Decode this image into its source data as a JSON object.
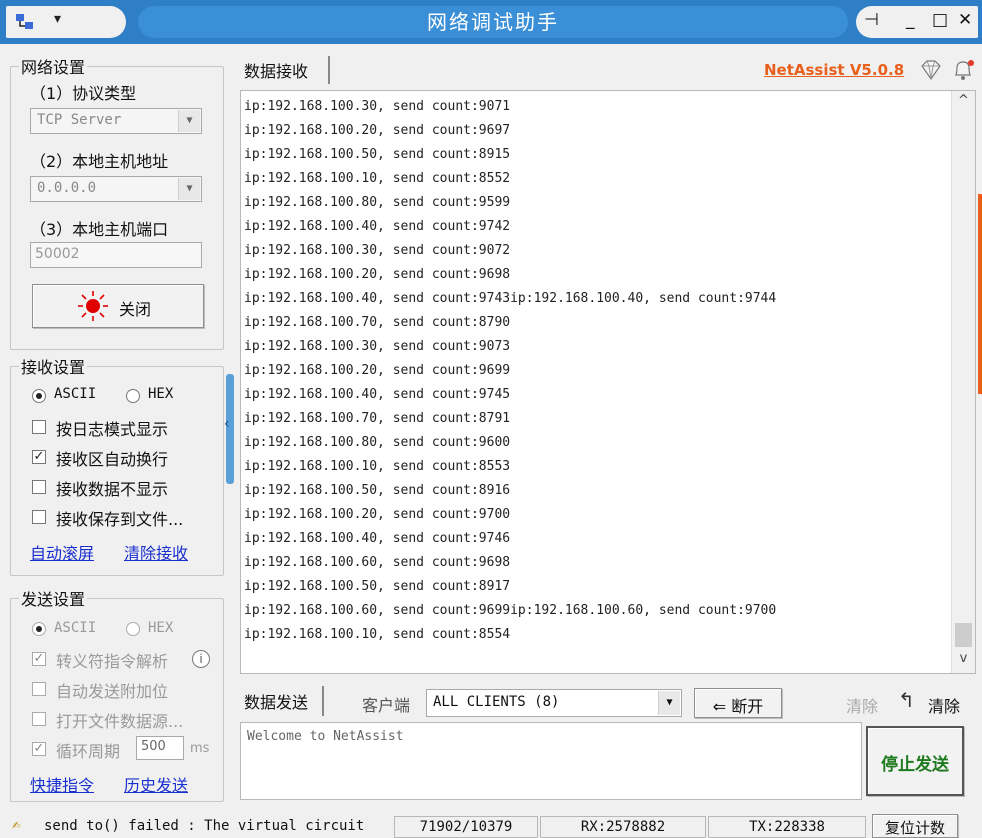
{
  "window": {
    "title": "网络调试助手",
    "brand": "NetAssist V5.0.8"
  },
  "network_settings": {
    "group": "网络设置",
    "protocol_label": "（1）协议类型",
    "protocol_value": "TCP Server",
    "host_label": "（2）本地主机地址",
    "host_value": "0.0.0.0",
    "port_label": "（3）本地主机端口",
    "port_value": "50002",
    "close_button": "关闭"
  },
  "receive_settings": {
    "group": "接收设置",
    "ascii": "ASCII",
    "hex": "HEX",
    "options": [
      "按日志模式显示",
      "接收区自动换行",
      "接收数据不显示",
      "接收保存到文件..."
    ],
    "auto_scroll": "自动滚屏",
    "clear_receive": "清除接收"
  },
  "send_settings": {
    "group": "发送设置",
    "ascii": "ASCII",
    "hex": "HEX",
    "options": [
      "转义符指令解析",
      "自动发送附加位",
      "打开文件数据源...",
      "循环周期"
    ],
    "cycle_value": "500",
    "cycle_unit": "ms",
    "shortcut": "快捷指令",
    "history": "历史发送"
  },
  "receive": {
    "tab": "数据接收",
    "lines": [
      "ip:192.168.100.30, send count:9071",
      "ip:192.168.100.20, send count:9697",
      "ip:192.168.100.50, send count:8915",
      "ip:192.168.100.10, send count:8552",
      "ip:192.168.100.80, send count:9599",
      "ip:192.168.100.40, send count:9742",
      "ip:192.168.100.30, send count:9072",
      "ip:192.168.100.20, send count:9698",
      "ip:192.168.100.40, send count:9743ip:192.168.100.40, send count:9744",
      "ip:192.168.100.70, send count:8790",
      "ip:192.168.100.30, send count:9073",
      "ip:192.168.100.20, send count:9699",
      "ip:192.168.100.40, send count:9745",
      "ip:192.168.100.70, send count:8791",
      "ip:192.168.100.80, send count:9600",
      "ip:192.168.100.10, send count:8553",
      "ip:192.168.100.50, send count:8916",
      "ip:192.168.100.20, send count:9700",
      "ip:192.168.100.40, send count:9746",
      "ip:192.168.100.60, send count:9698",
      "ip:192.168.100.50, send count:8917",
      "ip:192.168.100.60, send count:9699ip:192.168.100.60, send count:9700",
      "ip:192.168.100.10, send count:8554"
    ]
  },
  "send": {
    "tab": "数据发送",
    "client_label": "客户端",
    "client_value": "ALL CLIENTS (8)",
    "disconnect": "断开",
    "clear_dim": "清除",
    "clear": "清除",
    "text": "Welcome to NetAssist",
    "stop_button": "停止发送"
  },
  "status": {
    "message": "send to() failed : The virtual circuit",
    "counts": "71902/10379",
    "rx": "RX:2578882",
    "tx": "TX:228338",
    "reset": "复位计数"
  },
  "colors": {
    "titlebar": "#2e7fc6",
    "brand": "#e8601c",
    "link": "#1a2fd0",
    "stop_text": "#1f7a1f",
    "led": "#e00000"
  }
}
